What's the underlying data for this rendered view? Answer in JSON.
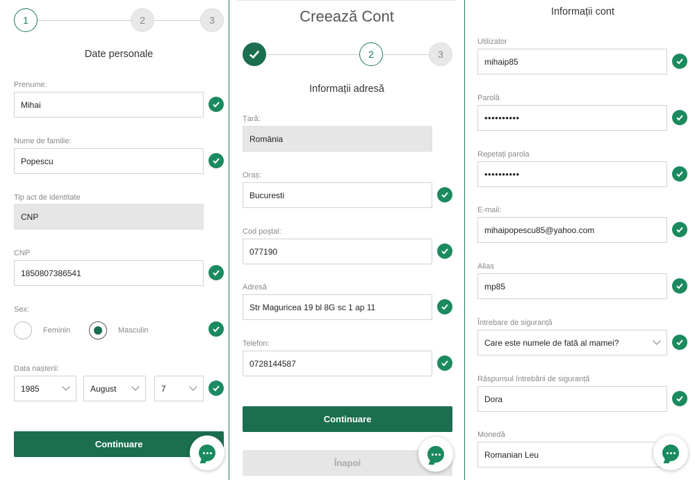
{
  "colors": {
    "accent": "#1b6e4f",
    "check": "#1b8a5f",
    "disabled": "#e6e6e6"
  },
  "panel1": {
    "steps": [
      "1",
      "2",
      "3"
    ],
    "title": "Date personale",
    "first_name": {
      "label": "Prenume:",
      "value": "Mihai"
    },
    "last_name": {
      "label": "Nume de familie:",
      "value": "Popescu"
    },
    "id_type": {
      "label": "Tip act de identitate",
      "value": "CNP"
    },
    "cnp": {
      "label": "CNP",
      "value": "1850807386541"
    },
    "sex": {
      "label": "Sex:",
      "options": [
        "Feminin",
        "Masculin"
      ],
      "selected": "Masculin"
    },
    "birth": {
      "label": "Data nașterii:",
      "year": "1985",
      "month": "August",
      "day": "7"
    },
    "continue_label": "Continuare"
  },
  "panel2": {
    "heading": "Creează Cont",
    "steps": [
      "2",
      "3"
    ],
    "title": "Informații adresă",
    "country": {
      "label": "Țară:",
      "value": "România"
    },
    "city": {
      "label": "Oraș:",
      "value": "Bucuresti"
    },
    "postal": {
      "label": "Cod poștal:",
      "value": "077190"
    },
    "address": {
      "label": "Adresă",
      "value": "Str Maguricea 19 bl 8G sc 1 ap 11"
    },
    "phone": {
      "label": "Telefon:",
      "value": "0728144587"
    },
    "continue_label": "Continuare",
    "back_label": "Înapoi"
  },
  "panel3": {
    "title": "Informații cont",
    "username": {
      "label": "Utilizator",
      "value": "mihaip85"
    },
    "password": {
      "label": "Parolă",
      "value": "••••••••••"
    },
    "repeat_password": {
      "label": "Repetați parola",
      "value": "••••••••••"
    },
    "email": {
      "label": "E-mail:",
      "value": "mihaipopescu85@yahoo.com"
    },
    "alias": {
      "label": "Alias",
      "value": "mp85"
    },
    "security_question": {
      "label": "Întrebare de siguranță",
      "value": "Care este numele de fată al mamei?"
    },
    "security_answer": {
      "label": "Răspunsul întrebării de siguranță",
      "value": "Dora"
    },
    "currency": {
      "label": "Monedă",
      "value": "Romanian Leu"
    }
  },
  "icons": {
    "check": "check-circle-icon",
    "chat": "chat-bubble-icon",
    "stepdone": "checkmark-icon"
  }
}
